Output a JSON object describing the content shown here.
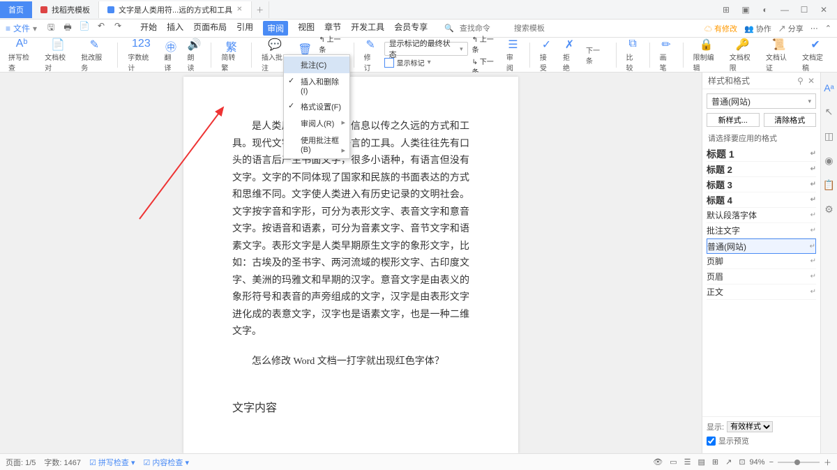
{
  "titlebar": {
    "home": "首页",
    "tab1": "找稻壳模板",
    "tab2": "文字是人类用符...远的方式和工具"
  },
  "menubar": {
    "file": "文件",
    "tabs": [
      "开始",
      "插入",
      "页面布局",
      "引用",
      "审阅",
      "视图",
      "章节",
      "开发工具",
      "会员专享"
    ],
    "active": "审阅",
    "searchCmd": "查找命令",
    "searchTpl": "搜索模板",
    "cloud": "有修改",
    "coop": "协作",
    "share": "分享"
  },
  "toolbar": {
    "g1": "拼写检查",
    "g2": "文档校对",
    "g3": "批改服务",
    "g4": "字数统计",
    "g5": "翻译",
    "g6": "朗读",
    "g7": "简转繁",
    "g8": "插入批注",
    "g9": "删除",
    "g10": "上一条",
    "g11": "下一条",
    "g12": "修订",
    "combo": "显示标记的最终状态",
    "combo_lbl": "显示标记",
    "g13": "上一条",
    "g14": "下一条",
    "g15": "审阅",
    "g16": "接受",
    "g17": "拒绝",
    "g18": "下一条",
    "g19": "比较",
    "g20": "画笔",
    "g21": "限制编辑",
    "g22": "文档权限",
    "g23": "文档认证",
    "g24": "文档定稿"
  },
  "dropdown": {
    "i1": "批注(C)",
    "i2": "插入和删除(I)",
    "i3": "格式设置(F)",
    "i4": "审阅人(R)",
    "i5": "使用批注框(B)"
  },
  "doc": {
    "p1": "是人类用符号记录表达信息以传之久远的方式和工具。现代文字大多是记录语言的工具。人类往往先有口头的语言后产生书面文字，很多小语种，有语言但没有文字。文字的不同体现了国家和民族的书面表达的方式和思维不同。文字使人类进入有历史记录的文明社会。文字按字音和字形，可分为表形文字、表音文字和意音文字。按语音和语素，可分为音素文字、音节文字和语素文字。表形文字是人类早期原生文字的象形文字，比如：古埃及的圣书字、两河流域的楔形文字、古印度文字、美洲的玛雅文和早期的汉字。意音文字是由表义的象形符号和表音的声旁组成的文字，汉字是由表形文字进化成的表意文字，汉字也是语素文字，也是一种二维文字。",
    "p2": "怎么修改 Word 文档一打字就出现红色字体？",
    "h": "文字内容"
  },
  "panel": {
    "title": "样式和格式",
    "sel": "普通(网站)",
    "btnNew": "新样式...",
    "btnClear": "清除格式",
    "label": "请选择要应用的格式",
    "styles": [
      {
        "name": "标题 1",
        "cls": "h1txt"
      },
      {
        "name": "标题 2",
        "cls": "h2txt"
      },
      {
        "name": "标题 3",
        "cls": "h2txt"
      },
      {
        "name": "标题 4",
        "cls": "h2txt"
      },
      {
        "name": "默认段落字体",
        "cls": ""
      },
      {
        "name": "批注文字",
        "cls": ""
      },
      {
        "name": "普通(网站)",
        "cls": "",
        "sel": true
      },
      {
        "name": "页脚",
        "cls": ""
      },
      {
        "name": "页眉",
        "cls": ""
      },
      {
        "name": "正文",
        "cls": ""
      }
    ],
    "showLbl": "显示:",
    "showVal": "有效样式",
    "preview": "显示预览"
  },
  "status": {
    "page": "页面: 1/5",
    "words": "字数: 1467",
    "spell": "拼写检查",
    "docchk": "内容检查",
    "zoom": "94%"
  }
}
